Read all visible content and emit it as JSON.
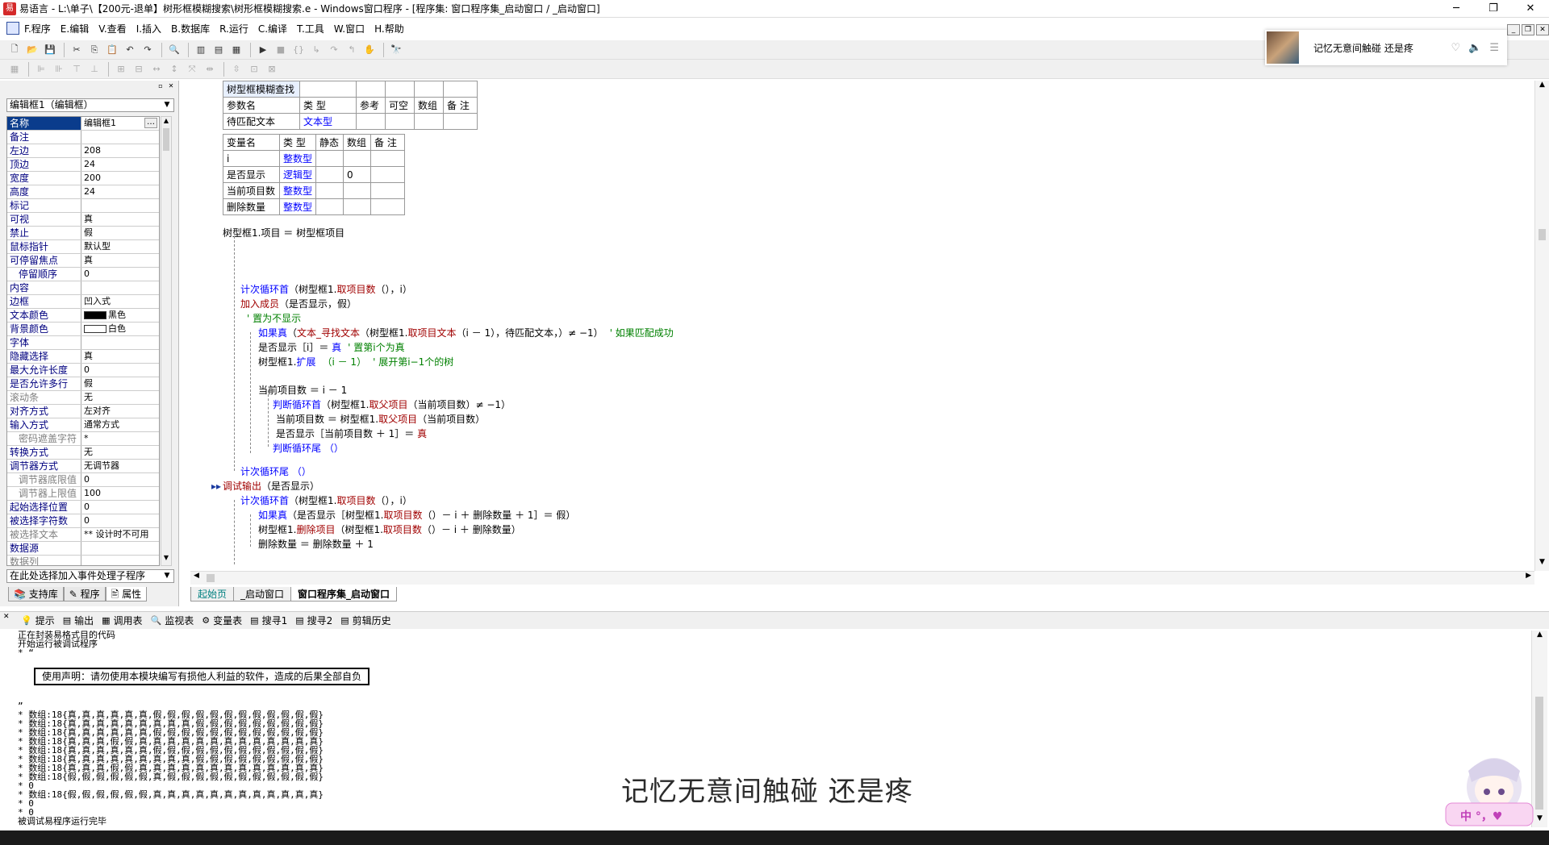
{
  "window": {
    "title": "易语言 - L:\\单子\\【200元-退单】树形框模糊搜索\\树形框模糊搜索.e - Windows窗口程序 - [程序集: 窗口程序集_启动窗口 / _启动窗口]",
    "min": "─",
    "max": "❐",
    "close": "✕"
  },
  "menu": [
    {
      "label": "F.程序"
    },
    {
      "label": "E.编辑"
    },
    {
      "label": "V.查看"
    },
    {
      "label": "I.插入"
    },
    {
      "label": "B.数据库"
    },
    {
      "label": "R.运行"
    },
    {
      "label": "C.编译"
    },
    {
      "label": "T.工具"
    },
    {
      "label": "W.窗口"
    },
    {
      "label": "H.帮助"
    }
  ],
  "music": {
    "song": "记忆无意间触碰  还是疼"
  },
  "left": {
    "component_select": "编辑框1（编辑框）",
    "event_select": "在此处选择加入事件处理子程序",
    "props": [
      {
        "n": "名称",
        "v": "编辑框1",
        "sel": true
      },
      {
        "n": "备注",
        "v": ""
      },
      {
        "n": "左边",
        "v": "208"
      },
      {
        "n": "顶边",
        "v": "24"
      },
      {
        "n": "宽度",
        "v": "200"
      },
      {
        "n": "高度",
        "v": "24"
      },
      {
        "n": "标记",
        "v": ""
      },
      {
        "n": "可视",
        "v": "真"
      },
      {
        "n": "禁止",
        "v": "假"
      },
      {
        "n": "鼠标指针",
        "v": "默认型"
      },
      {
        "n": "可停留焦点",
        "v": "真"
      },
      {
        "n": "停留顺序",
        "v": "0",
        "ind": true
      },
      {
        "n": "内容",
        "v": ""
      },
      {
        "n": "边框",
        "v": "凹入式"
      },
      {
        "n": "文本颜色",
        "v": "黑色",
        "sw": "#000000"
      },
      {
        "n": "背景颜色",
        "v": "白色",
        "sw": "#ffffff"
      },
      {
        "n": "字体",
        "v": ""
      },
      {
        "n": "隐藏选择",
        "v": "真"
      },
      {
        "n": "最大允许长度",
        "v": "0"
      },
      {
        "n": "是否允许多行",
        "v": "假"
      },
      {
        "n": "滚动条",
        "v": "无",
        "g": true
      },
      {
        "n": "对齐方式",
        "v": "左对齐"
      },
      {
        "n": "输入方式",
        "v": "通常方式"
      },
      {
        "n": "密码遮盖字符",
        "v": "*",
        "ind": true,
        "g": true
      },
      {
        "n": "转换方式",
        "v": "无"
      },
      {
        "n": "调节器方式",
        "v": "无调节器"
      },
      {
        "n": "调节器底限值",
        "v": "0",
        "ind": true,
        "g": true
      },
      {
        "n": "调节器上限值",
        "v": "100",
        "ind": true,
        "g": true
      },
      {
        "n": "起始选择位置",
        "v": "0"
      },
      {
        "n": "被选择字符数",
        "v": "0"
      },
      {
        "n": "被选择文本",
        "v": "** 设计时不可用",
        "g": true
      },
      {
        "n": "数据源",
        "v": ""
      },
      {
        "n": "数据列",
        "v": "",
        "g": true
      }
    ],
    "tabs": [
      {
        "label": "支持库"
      },
      {
        "label": "程序"
      },
      {
        "label": "属性"
      }
    ]
  },
  "editor": {
    "sub": {
      "name": "树型框模糊查找",
      "h": [
        "参数名",
        "类 型",
        "参考",
        "可空",
        "数组",
        "备 注"
      ],
      "p": [
        "待匹配文本",
        "文本型"
      ]
    },
    "vars": {
      "h": [
        "变量名",
        "类 型",
        "静态",
        "数组",
        "备 注"
      ],
      "rows": [
        [
          "i",
          "整数型",
          ""
        ],
        [
          "是否显示",
          "逻辑型",
          "0"
        ],
        [
          "当前项目数",
          "整数型",
          ""
        ],
        [
          "删除数量",
          "整数型",
          ""
        ]
      ]
    },
    "lines": [
      {
        "k": "a",
        "t": "树型框1.项目 ＝ 树型框项目"
      },
      {
        "k": "b1",
        "a": "计次循环首",
        "b": "（树型框1.",
        "c": "取项目数",
        "d": "（），i）"
      },
      {
        "k": "r",
        "a": "加入成员",
        "b": "（是否显示，假）"
      },
      {
        "k": "g",
        "t": "' 置为不显示"
      },
      {
        "k": "if1",
        "a": "如果真",
        "b": "（",
        "c": "文本_寻找文本",
        "d": "（树型框1.",
        "e": "取项目文本",
        "f": "（i － 1），待匹配文本，）≠ −1）",
        "g": "' 如果匹配成功"
      },
      {
        "k": "s",
        "a": "是否显示［i］＝ ",
        "b": "真",
        "c": "' 置第i个为真"
      },
      {
        "k": "s",
        "a": "树型框1.",
        "b": "扩展",
        "c": "（i － 1）",
        "d": "' 展开第i−1个的树"
      },
      {
        "k": "s2",
        "t": "当前项目数 ＝ i － 1"
      },
      {
        "k": "w",
        "a": "判断循环首",
        "b": "（树型框1.",
        "c": "取父项目",
        "d": "（当前项目数）≠ −1）"
      },
      {
        "k": "s3",
        "a": "当前项目数 ＝ 树型框1.",
        "b": "取父项目",
        "c": "（当前项目数）"
      },
      {
        "k": "s3",
        "a": "是否显示［当前项目数 ＋ 1］＝ ",
        "b": "真"
      },
      {
        "k": "we",
        "t": "判断循环尾 （）"
      },
      {
        "k": "le",
        "t": "计次循环尾 （）"
      },
      {
        "k": "dbg",
        "a": "调试输出",
        "b": "（是否显示）"
      },
      {
        "k": "b2",
        "a": "计次循环首",
        "b": "（树型框1.",
        "c": "取项目数",
        "d": "（），i）"
      },
      {
        "k": "if2",
        "a": "如果真",
        "b": "（是否显示［树型框1.",
        "c": "取项目数",
        "d": "（）－ i ＋ 删除数量 ＋ 1］＝ 假）"
      },
      {
        "k": "s4",
        "a": "树型框1.",
        "b": "删除项目",
        "c": "（树型框1.",
        "d": "取项目数",
        "e": "（）－ i ＋ 删除数量）"
      },
      {
        "k": "s5",
        "t": "删除数量 ＝ 删除数量 ＋ 1"
      }
    ],
    "tabs": [
      {
        "label": "起始页"
      },
      {
        "label": "_启动窗口"
      },
      {
        "label": "窗口程序集_启动窗口"
      }
    ]
  },
  "output": {
    "tabs": [
      {
        "icon": "💡",
        "label": "提示"
      },
      {
        "icon": "▤",
        "label": "输出"
      },
      {
        "icon": "▦",
        "label": "调用表"
      },
      {
        "icon": "🔍",
        "label": "监视表"
      },
      {
        "icon": "⚙",
        "label": "变量表"
      },
      {
        "icon": "▤",
        "label": "搜寻1"
      },
      {
        "icon": "▤",
        "label": "搜寻2"
      },
      {
        "icon": "▤",
        "label": "剪辑历史"
      }
    ],
    "lines": [
      "正在封装易格式目的代码",
      "开始运行被调试程序",
      "* “",
      "",
      "",
      "",
      "",
      "",
      "”",
      "* 数组:18{真,真,真,真,真,真,假,假,假,假,假,假,假,假,假,假,假,假}",
      "* 数组:18{真,真,真,真,真,真,真,真,真,假,假,假,假,假,假,假,假,假}",
      "* 数组:18{真,真,真,真,真,真,假,假,假,假,假,假,假,假,假,假,假,假}",
      "* 数组:18{真,真,真,假,假,真,真,真,真,真,真,真,真,真,真,真,真,真}",
      "* 数组:18{真,真,真,真,真,真,假,假,假,假,假,假,假,假,假,假,假,假}",
      "* 数组:18{真,真,真,真,真,真,真,真,真,假,假,假,假,假,假,假,假,假}",
      "* 数组:18{真,真,真,假,假,真,真,真,真,真,真,真,真,真,真,真,真,真}",
      "* 数组:18{假,假,假,假,假,假,真,假,假,假,假,假,假,假,假,假,假,假}",
      "* 0",
      "* 数组:18{假,假,假,假,假,假,真,真,真,真,真,真,真,真,真,真,真,真}",
      "* 0",
      "* 0",
      "被调试易程序运行完毕"
    ],
    "disclaimer": "使用声明：请勿使用本模块编写有损他人利益的软件，造成的后果全部自负"
  },
  "lyric": "记忆无意间触碰 还是疼",
  "mascot_badge": "中 °，♥"
}
